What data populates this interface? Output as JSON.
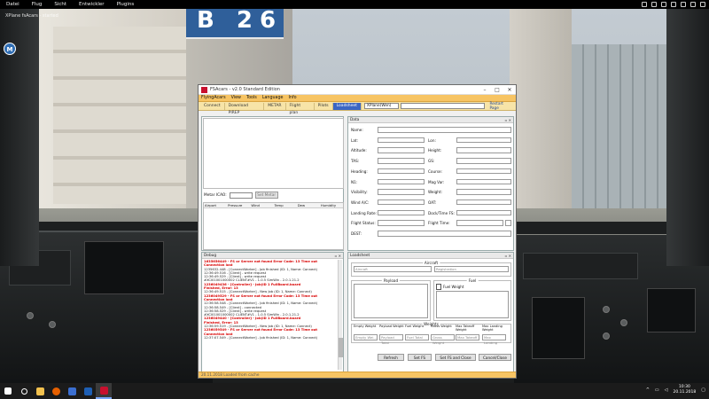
{
  "sim_menu": {
    "items": [
      "Datei",
      "Flug",
      "Sicht",
      "Entwickler",
      "Plugins"
    ]
  },
  "scene": {
    "gate_sign": "B 26",
    "overlay_text": "XPlane fsAcars - started",
    "marker": "M"
  },
  "window": {
    "title": "FSAcars - v2.0 Standard Edition",
    "menu": [
      "FlyingAcars",
      "View",
      "Tools",
      "Language",
      "Info"
    ],
    "toolbar": [
      "Connect",
      "Download PIREP",
      "METAR",
      "Flight plan",
      "Pilots",
      "Loadsheet"
    ],
    "active_tab": "Loadsheet",
    "sim_select": "XPlane(Wen)",
    "toolbar_right": "Restart Page",
    "status": "20.11.2018 Loaded from cache"
  },
  "weather": {
    "metar_label": "Metar ICAO:",
    "set_metar": "Set Metar",
    "columns": [
      "Airport",
      "Pressure",
      "Wind",
      "Temp",
      "Dew",
      "Humidity"
    ]
  },
  "data": {
    "header": "Data",
    "left_labels": [
      "Name:",
      "Lat:",
      "Altitude:",
      "TAS:",
      "Heading:",
      "N1:",
      "Visibility:",
      "Wind A/C:",
      "Landing Rate:",
      "Flight Status:",
      "DEST:"
    ],
    "right_labels": [
      "",
      "Lon:",
      "Height:",
      "GS:",
      "Course:",
      "Mag Var:",
      "Weight:",
      "OAT:",
      "Dock/Time FS:",
      "Flight Time:"
    ]
  },
  "debug": {
    "header": "Debug",
    "lines": [
      {
        "t": "e",
        "text": "1635656449 - FS or Server not found Error Code: 13 Time out"
      },
      {
        "t": "e",
        "text": "Connection lost"
      },
      {
        "t": "n",
        "text": "1235632.448 - [ConnectWorker] - Job finished (ID: 1, Name: Connect)"
      },
      {
        "t": "n",
        "text": "12:36:49.516 - [Client] - write request"
      },
      {
        "t": "n",
        "text": "12:36:49.529 - [Client] - write request"
      },
      {
        "t": "n",
        "text": "#XCI01001000002 CLIENT#V1 - 1.0.5 SimWin - 2.0.1.21.2"
      },
      {
        "t": "e",
        "text": "1236049436 - [Controller] - Job(ID 1 FullBoard.board"
      },
      {
        "t": "e",
        "text": "Finished, Error: 13"
      },
      {
        "t": "n",
        "text": "12:36:49.515 - [ConnectWorker] - New Job (ID: 1, Name: Connect)"
      },
      {
        "t": "e",
        "text": "1236049529 - FS or Server not found Error Code: 13 Time out"
      },
      {
        "t": "e",
        "text": "Connection lost"
      },
      {
        "t": "n",
        "text": "12:36:58.548 - [ConnectWorker] - Job finished (ID: 1, Name: Connect)"
      },
      {
        "t": "n",
        "text": "12:36:58.549 - [Client] - connected"
      },
      {
        "t": "n",
        "text": "12:36:58.529 - [Client] - write request"
      },
      {
        "t": "n",
        "text": "#XCI01001000002 CLIENT#V1 - 1.0.5 SimWin - 2.0.1.21.2"
      },
      {
        "t": "e",
        "text": "1236049440 - [Controller] - Job(ID 1 FullBoard.board"
      },
      {
        "t": "e",
        "text": "Finished, Error: 13"
      },
      {
        "t": "n",
        "text": "12:36:59.519 - [ConnectWorker] - New Job (ID: 1, Name: Connect)"
      },
      {
        "t": "e",
        "text": "1236059549 - FS or Server not found Error Code: 13 Time out"
      },
      {
        "t": "e",
        "text": "Connection lost"
      },
      {
        "t": "n",
        "text": "12:37:07.549 - [ConnectWorker] - Job finished (ID: 1, Name: Connect)"
      }
    ]
  },
  "loadsheet": {
    "header": "Loadsheet",
    "aircraft_group": "Aircraft",
    "aircraft_placeholder": "Aircraft",
    "registration_placeholder": "Registration",
    "payload_group": "Payload",
    "fuel_group": "Fuel",
    "fuel_weight_check": "Fuel Weight",
    "weights_group": "Weights",
    "weight_labels": [
      "Empty Weight",
      "Payload Weight",
      "Fuel Weight",
      "Gross Weight",
      "Max Takeoff Weight",
      "Max Landing Weight"
    ],
    "weight_placeholders": [
      "Empty Wei...",
      "Payload Total",
      "Fuel Total",
      "Gross Weight",
      "Max Takeoff",
      "Max Landing"
    ],
    "buttons": [
      "Refresh",
      "Set FS",
      "Set FS and Close",
      "Cancel/Close"
    ]
  },
  "taskbar": {
    "time": "10:30",
    "date": "20.11.2018"
  },
  "colors": {
    "menu_accent": "#f7c463",
    "error_text": "#d80000",
    "active_tab": "#3b66c4"
  }
}
